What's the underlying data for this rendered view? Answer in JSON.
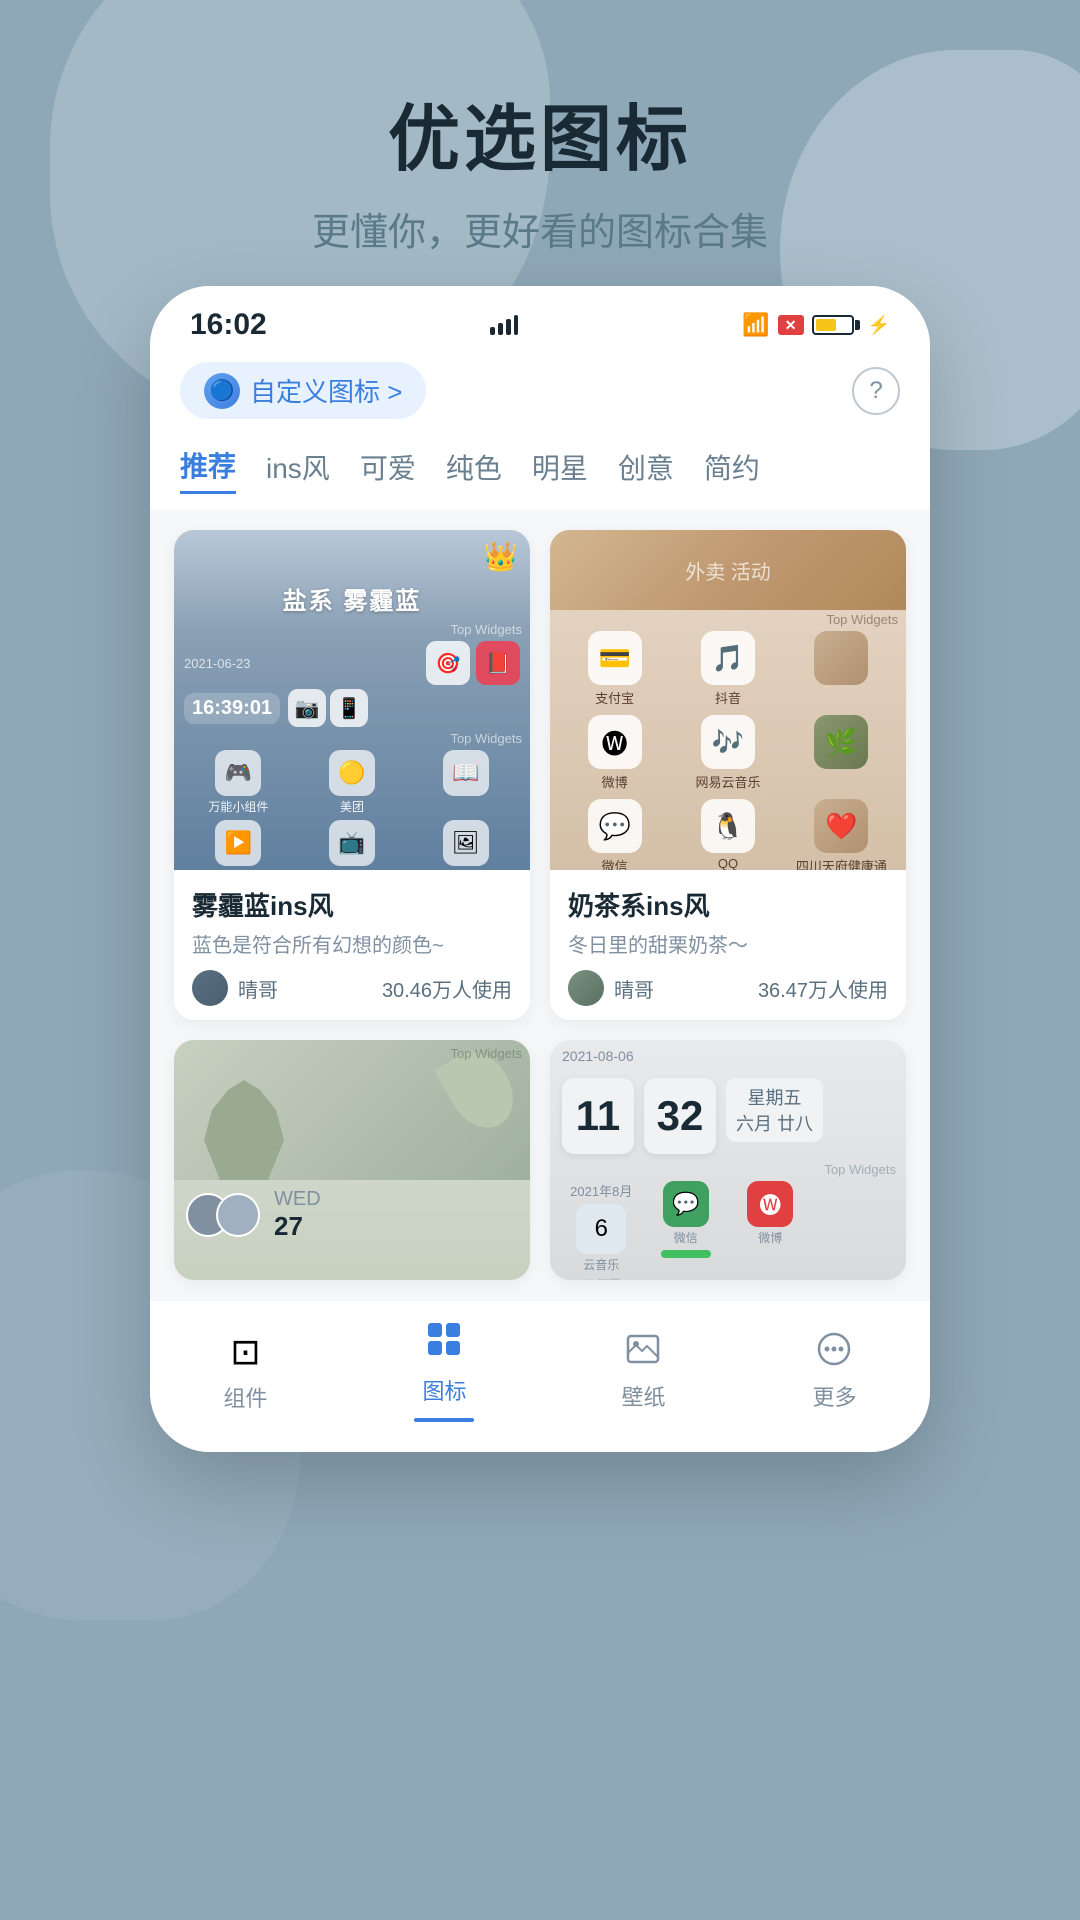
{
  "header": {
    "title": "优选图标",
    "subtitle": "更懂你，更好看的图标合集"
  },
  "status_bar": {
    "time": "16:02",
    "signal_label": "signal",
    "wifi_label": "wifi",
    "battery_label": "battery"
  },
  "top_bar": {
    "custom_icon_label": "自定义图标 >",
    "help_label": "?"
  },
  "categories": [
    {
      "id": "recommend",
      "label": "推荐",
      "active": true
    },
    {
      "id": "ins",
      "label": "ins风",
      "active": false
    },
    {
      "id": "cute",
      "label": "可爱",
      "active": false
    },
    {
      "id": "pure",
      "label": "纯色",
      "active": false
    },
    {
      "id": "star",
      "label": "明星",
      "active": false
    },
    {
      "id": "creative",
      "label": "创意",
      "active": false
    },
    {
      "id": "simple",
      "label": "简约",
      "active": false
    }
  ],
  "themes": [
    {
      "id": "haze-blue",
      "name": "雾霾蓝ins风",
      "desc": "蓝色是符合所有幻想的颜色~",
      "author": "晴哥",
      "usage": "30.46万人使用",
      "preview_title": "盐系 雾霾蓝",
      "has_crown": true
    },
    {
      "id": "milk-tea",
      "name": "奶茶系ins风",
      "desc": "冬日里的甜栗奶茶～",
      "author": "晴哥",
      "usage": "36.47万人使用",
      "has_crown": false
    },
    {
      "id": "theme3",
      "name": "",
      "desc": "",
      "author": "",
      "usage": "",
      "has_crown": false
    },
    {
      "id": "theme4",
      "date_display": "2021-08-06",
      "num1": "11",
      "num2": "32",
      "day": "星期五",
      "lunar": "六月 廿八",
      "name": "",
      "desc": "",
      "author": "",
      "usage": "",
      "has_crown": false
    }
  ],
  "bottom_nav": {
    "items": [
      {
        "id": "widgets",
        "label": "组件",
        "active": false,
        "icon": "⊡"
      },
      {
        "id": "icons",
        "label": "图标",
        "active": true,
        "icon": "⊞"
      },
      {
        "id": "wallpaper",
        "label": "壁纸",
        "active": false,
        "icon": "⊟"
      },
      {
        "id": "more",
        "label": "更多",
        "active": false,
        "icon": "⊙"
      }
    ]
  }
}
